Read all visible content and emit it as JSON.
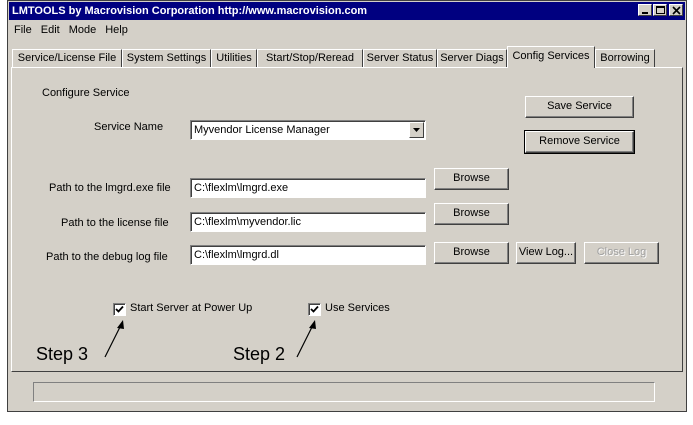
{
  "window": {
    "title": "LMTOOLS by Macrovision Corporation http://www.macrovision.com"
  },
  "menu": [
    "File",
    "Edit",
    "Mode",
    "Help"
  ],
  "tabs": [
    "Service/License File",
    "System Settings",
    "Utilities",
    "Start/Stop/Reread",
    "Server Status",
    "Server Diags",
    "Config Services",
    "Borrowing"
  ],
  "active_tab": "Config Services",
  "config": {
    "section_label": "Configure Service",
    "service_name_label": "Service Name",
    "service_name_value": "Myvendor License Manager",
    "lmgrd_label": "Path to the lmgrd.exe file",
    "lmgrd_value": "C:\\flexlm\\lmgrd.exe",
    "license_label": "Path to the license file",
    "license_value": "C:\\flexlm\\myvendor.lic",
    "debug_label": "Path to the debug log file",
    "debug_value": "C:\\flexlm\\lmgrd.dl",
    "save_service": "Save Service",
    "remove_service": "Remove Service",
    "browse": "Browse",
    "view_log": "View Log...",
    "close_log": "Close Log",
    "start_at_powerup_label": "Start Server at Power Up",
    "start_at_powerup_checked": true,
    "use_services_label": "Use Services",
    "use_services_checked": true
  },
  "annotations": {
    "step3": "Step 3",
    "step2": "Step 2"
  },
  "icons": {
    "minimize": "minimize-icon",
    "maximize": "maximize-icon",
    "close": "close-icon",
    "dropdown": "chevron-down-icon",
    "check": "checkmark-icon"
  },
  "colors": {
    "titlebar": "#000080",
    "face": "#d4d0c8"
  }
}
